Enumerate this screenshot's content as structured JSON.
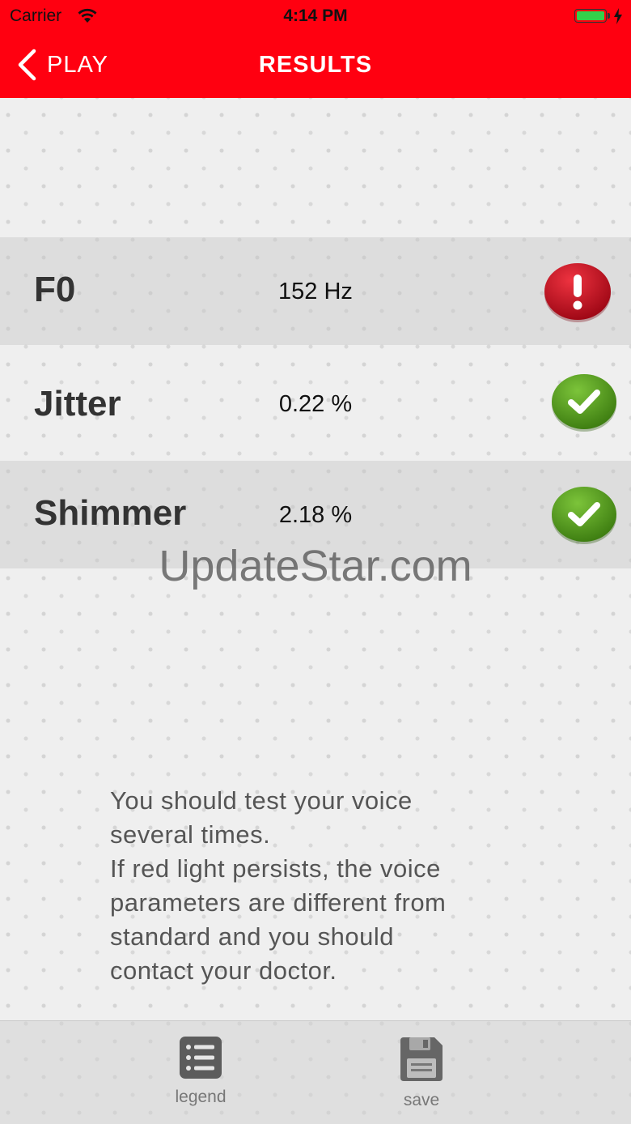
{
  "status_bar": {
    "carrier": "Carrier",
    "time": "4:14 PM",
    "battery_color": "#33d04a"
  },
  "nav": {
    "back_label": "PLAY",
    "title": "RESULTS",
    "bar_color": "#ff0010"
  },
  "results": [
    {
      "label": "F0",
      "value": "152 Hz",
      "status": "alert",
      "status_icon": "exclamation-icon",
      "status_color": "#c8101e"
    },
    {
      "label": "Jitter",
      "value": "0.22 %",
      "status": "ok",
      "status_icon": "checkmark-icon",
      "status_color": "#4e9a1c"
    },
    {
      "label": "Shimmer",
      "value": "2.18 %",
      "status": "ok",
      "status_icon": "checkmark-icon",
      "status_color": "#4e9a1c"
    }
  ],
  "watermark": "UpdateStar.com",
  "info_lines": [
    "You should test your voice",
    "several times.",
    "If red light persists, the voice",
    "parameters are different from",
    "standard and you should",
    "contact your doctor."
  ],
  "tabs": {
    "legend": {
      "label": "legend",
      "icon": "list-icon"
    },
    "save": {
      "label": "save",
      "icon": "floppy-disk-icon"
    }
  }
}
